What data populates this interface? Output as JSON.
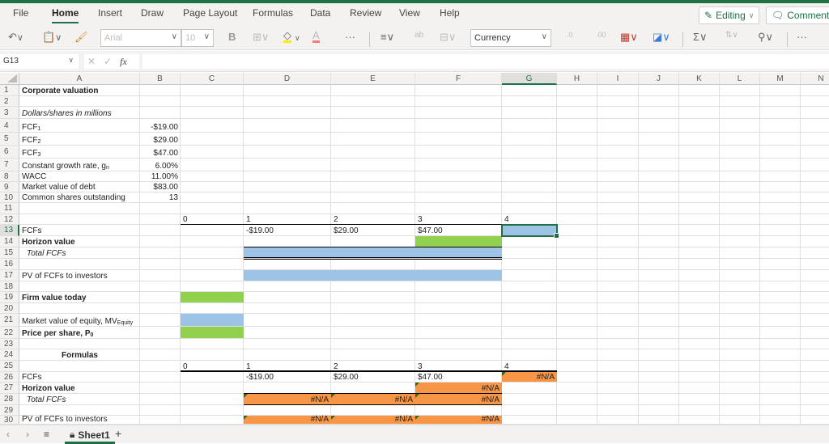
{
  "app": {
    "menu": [
      "File",
      "Home",
      "Insert",
      "Draw",
      "Page Layout",
      "Formulas",
      "Data",
      "Review",
      "View",
      "Help"
    ],
    "active_menu": "Home",
    "editing_label": "Editing",
    "comments_label": "Comments"
  },
  "ribbon": {
    "font_name": "Arial",
    "font_size": "10",
    "bold_label": "B",
    "number_format": "Currency",
    "more_label": "···"
  },
  "formula_bar": {
    "name_box": "G13",
    "fx_label": "fx",
    "formula": ""
  },
  "columns": [
    "A",
    "B",
    "C",
    "D",
    "E",
    "F",
    "G",
    "H",
    "I",
    "J",
    "K",
    "L",
    "M",
    "N"
  ],
  "selected_column": "G",
  "selected_row": "13",
  "rows": [
    "1",
    "2",
    "3",
    "4",
    "5",
    "6",
    "7",
    "8",
    "9",
    "10",
    "11",
    "12",
    "13",
    "14",
    "15",
    "16",
    "17",
    "18",
    "19",
    "20",
    "21",
    "22",
    "23",
    "24",
    "25",
    "26",
    "27",
    "28",
    "29",
    "30"
  ],
  "cells": {
    "A1": "Corporate valuation",
    "A3": "Dollars/shares in millions",
    "A4": "FCF",
    "A4_sub": "1",
    "B4": "-$19.00",
    "A5": "FCF",
    "A5_sub": "2",
    "B5": "$29.00",
    "A6": "FCF",
    "A6_sub": "3",
    "B6": "$47.00",
    "A7": "Constant growth rate, g",
    "A7_sub": "n",
    "B7": "6.00%",
    "A8": "WACC",
    "B8": "11.00%",
    "A9": "Market value of debt",
    "B9": "$83.00",
    "A10": "Common shares outstanding",
    "B10": "13",
    "C12": "0",
    "D12": "1",
    "E12": "2",
    "F12": "3",
    "G12": "4",
    "A13": "FCFs",
    "D13": "-$19.00",
    "E13": "$29.00",
    "F13": "$47.00",
    "A14": "Horizon value",
    "A15": "Total FCFs",
    "A17": "PV of FCFs to investors",
    "A19": "Firm value today",
    "A21": "Market value of equity, MV",
    "A21_sub": "Equity",
    "A22": "Price per share, P",
    "A22_sub": "0",
    "A24": "Formulas",
    "C25": "0",
    "D25": "1",
    "E25": "2",
    "F25": "3",
    "G25": "4",
    "A26": "FCFs",
    "D26": "-$19.00",
    "E26": "$29.00",
    "F26": "$47.00",
    "G26": "#N/A",
    "A27": "Horizon value",
    "F27": "#N/A",
    "A28": "Total FCFs",
    "D28": "#N/A",
    "E28": "#N/A",
    "F28": "#N/A",
    "A30": "PV of FCFs to investors",
    "D30": "#N/A",
    "E30": "#N/A",
    "F30": "#N/A"
  },
  "sheets": [
    "Sheet1"
  ],
  "colors": {
    "accent": "#1e7145",
    "input_blue": "#9dc3e6",
    "output_green": "#92d050",
    "error_orange": "#f79646"
  }
}
